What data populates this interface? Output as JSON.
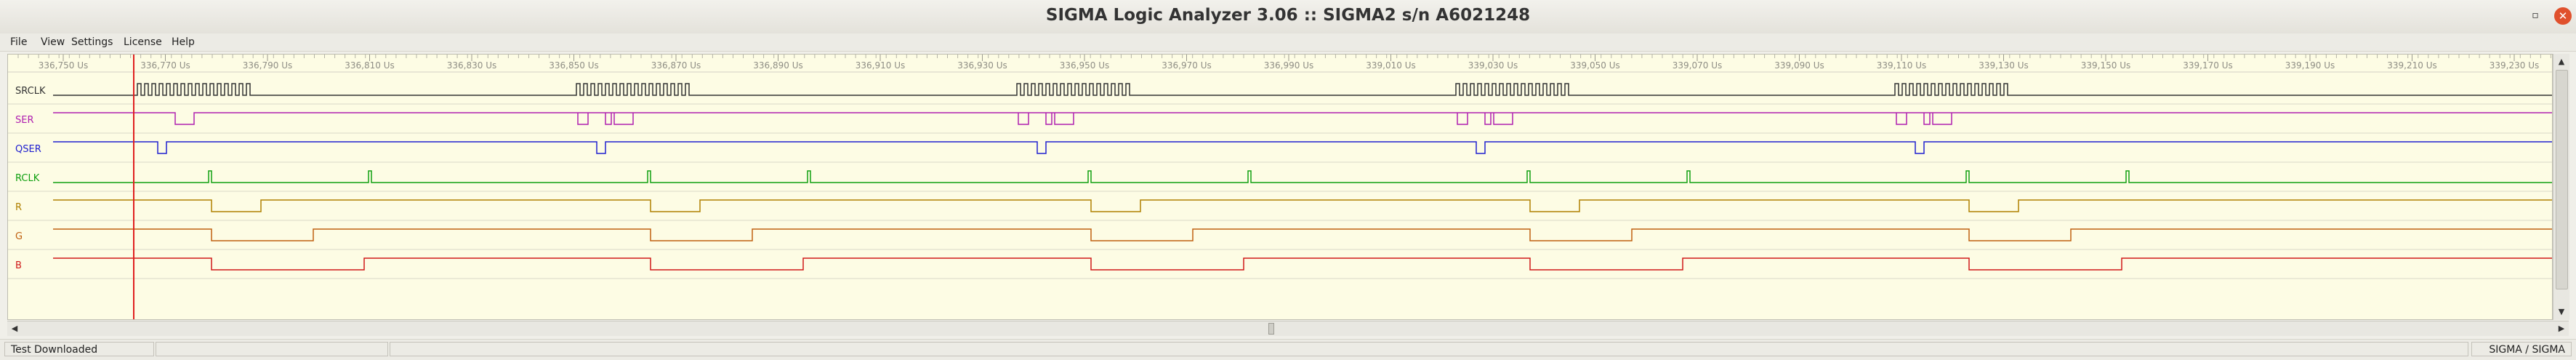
{
  "window": {
    "title": "SIGMA Logic Analyzer 3.06 :: SIGMA2 s/n A6021248",
    "restore_glyph": "▫",
    "close_glyph": "✕"
  },
  "menu": [
    "File",
    "View",
    "Settings",
    "License",
    "Help"
  ],
  "timeline": {
    "ticks": [
      "336,750 Us",
      "336,770 Us",
      "336,790 Us",
      "336,810 Us",
      "336,830 Us",
      "336,850 Us",
      "336,870 Us",
      "336,890 Us",
      "336,910 Us",
      "336,930 Us",
      "336,950 Us",
      "336,970 Us",
      "336,990 Us",
      "339,010 Us",
      "339,030 Us",
      "339,050 Us",
      "339,070 Us",
      "339,090 Us",
      "339,110 Us",
      "339,130 Us",
      "339,150 Us",
      "339,170 Us",
      "339,190 Us",
      "339,210 Us",
      "339,230 Us"
    ],
    "cursor_color": "#e02020"
  },
  "channels": [
    {
      "name": "SRCLK",
      "color": "#333333"
    },
    {
      "name": "SER",
      "color": "#b020b0"
    },
    {
      "name": "QSER",
      "color": "#2020d0"
    },
    {
      "name": "RCLK",
      "color": "#10a010"
    },
    {
      "name": "R",
      "color": "#b08000"
    },
    {
      "name": "G",
      "color": "#c06010"
    },
    {
      "name": "B",
      "color": "#d01818"
    }
  ],
  "status": {
    "message": "Test Downloaded",
    "right": "SIGMA / SIGMA"
  },
  "icons": {
    "scroll_up": "▲",
    "scroll_down": "▼",
    "scroll_left": "◀",
    "scroll_right": "▶"
  }
}
